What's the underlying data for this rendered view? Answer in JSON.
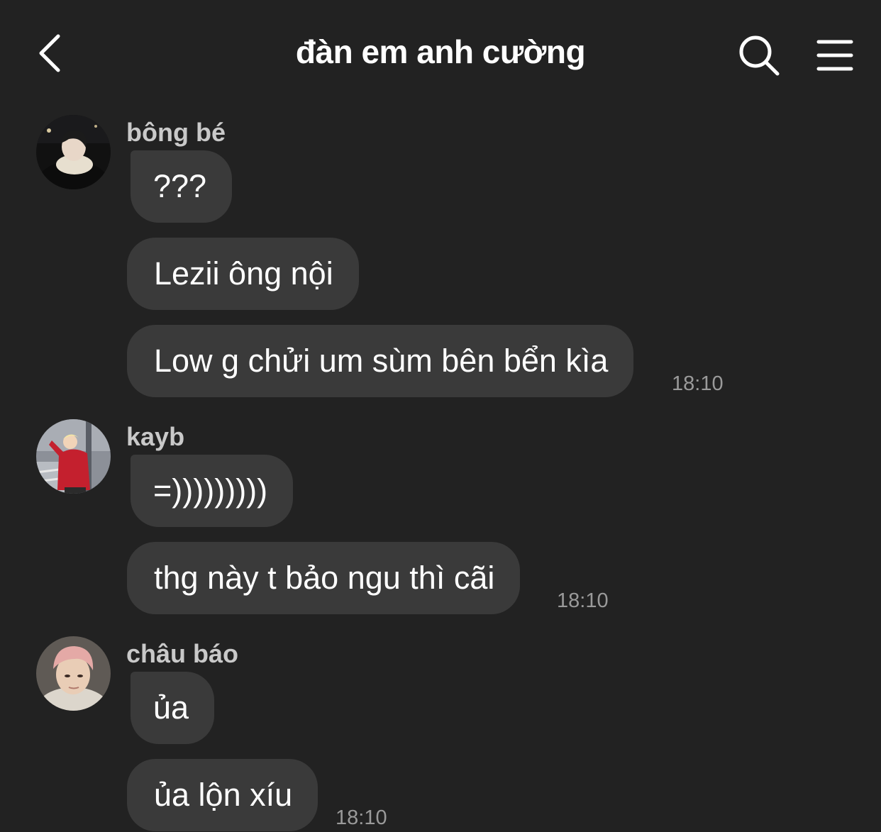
{
  "header": {
    "title": "đàn em anh cường",
    "back_icon": "chevron-left-icon",
    "search_icon": "search-icon",
    "menu_icon": "hamburger-menu-icon"
  },
  "groups": [
    {
      "sender": "bông bé",
      "messages": [
        "???",
        "Lezii ông nội",
        "Low g chửi um sùm bên bển kìa"
      ],
      "time": "18:10"
    },
    {
      "sender": "kayb",
      "messages": [
        "=)))))))))",
        "thg này t bảo ngu thì cãi"
      ],
      "time": "18:10"
    },
    {
      "sender": "châu báo",
      "messages": [
        "ủa",
        "ủa lộn xíu"
      ],
      "time": "18:10"
    }
  ],
  "colors": {
    "background": "#222222",
    "bubble": "#3a3a3a",
    "sender_name": "#c9c9c9",
    "timestamp": "#9a9a9a"
  }
}
